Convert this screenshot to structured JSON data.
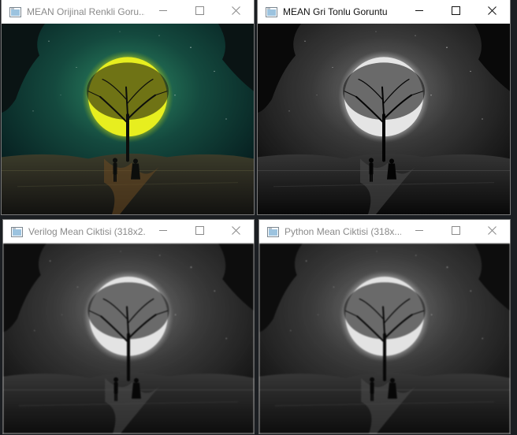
{
  "windows": [
    {
      "title": "MEAN Orijinal Renkli Goru...",
      "active": false
    },
    {
      "title": "MEAN Gri Tonlu Goruntu",
      "active": true
    },
    {
      "title": "Verilog Mean Ciktisi (318x2...",
      "active": false
    },
    {
      "title": "Python Mean Ciktisi (318x...",
      "active": false
    }
  ],
  "icons": {
    "app": "window-app-icon",
    "minimize": "minimize-icon",
    "maximize": "maximize-icon",
    "close": "close-icon"
  },
  "colors": {
    "titlebar": "#ffffff",
    "inactive_title": "#8a8a8a",
    "active_title": "#111111",
    "moon": "#e7ee1f",
    "sky_top": "#062a2a",
    "sky_glow": "#1f6a52"
  }
}
